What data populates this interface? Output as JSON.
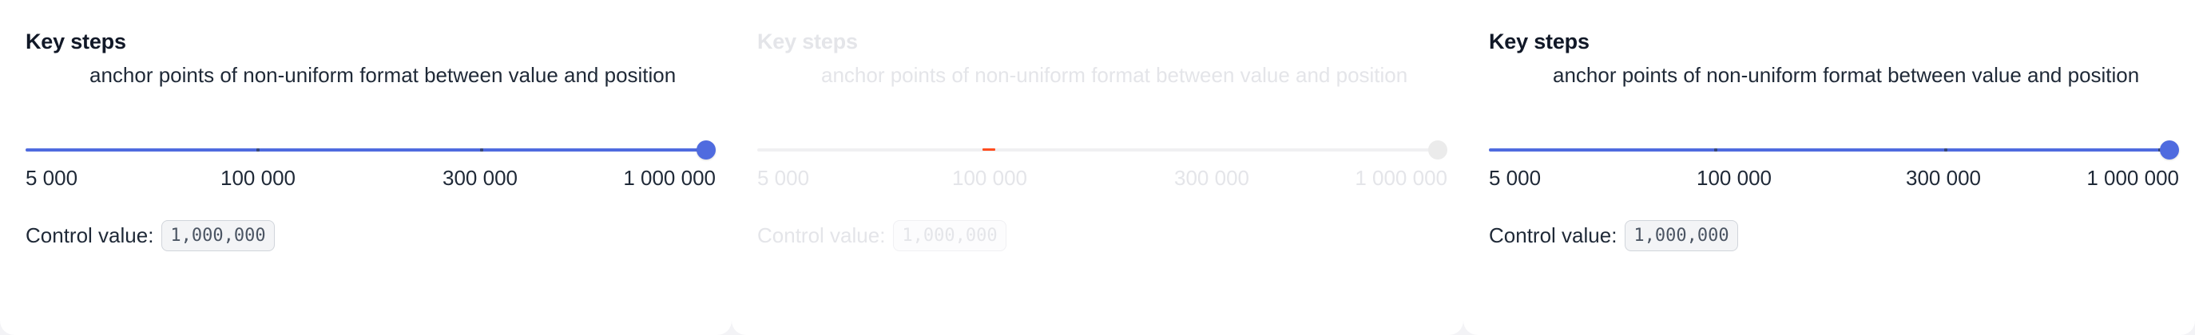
{
  "colors": {
    "accent": "#4f6bdf",
    "text": "#111827",
    "disabled_text": "#e4e5e9",
    "disabled_marker": "#ff4d1f"
  },
  "panels": [
    {
      "title": "Key steps",
      "description": "anchor points of non-uniform format between value and position",
      "slider": {
        "value": 1000000,
        "steps": [
          "5 000",
          "100 000",
          "300 000",
          "1 000 000"
        ]
      },
      "control_label": "Control value:",
      "control_value": "1,000,000",
      "disabled": false
    },
    {
      "title": "Key steps",
      "description": "anchor points of non-uniform format between value and position",
      "slider": {
        "value": 1000000,
        "steps": [
          "5 000",
          "100 000",
          "300 000",
          "1 000 000"
        ]
      },
      "control_label": "Control value:",
      "control_value": "1,000,000",
      "disabled": true
    },
    {
      "title": "Key steps",
      "description": "anchor points of non-uniform format between value and position",
      "slider": {
        "value": 1000000,
        "steps": [
          "5 000",
          "100 000",
          "300 000",
          "1 000 000"
        ]
      },
      "control_label": "Control value:",
      "control_value": "1,000,000",
      "disabled": false
    }
  ]
}
